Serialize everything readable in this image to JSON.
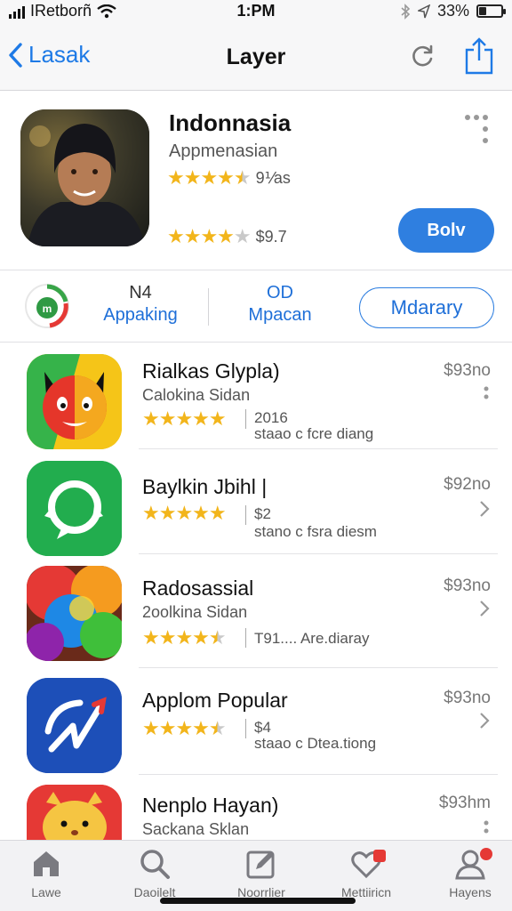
{
  "status_bar": {
    "carrier": "IRetborñ",
    "time": "1:PM",
    "battery_percent_label": "33%",
    "battery_level": 0.33
  },
  "nav": {
    "back_label": "Lasak",
    "title": "Layer"
  },
  "featured_app": {
    "name": "Indonnasia",
    "subtitle": "Appmenasian",
    "rating_1": 4.5,
    "rating_1_meta": "9⅟as",
    "rating_2": 4,
    "rating_2_meta": "$9.7",
    "buy_label": "Bolv"
  },
  "stats": {
    "stat_1_top": "N4",
    "stat_1_bottom": "Appaking",
    "stat_2_top": "OD",
    "stat_2_bottom": "Mpacan",
    "details_label": "Mdarary"
  },
  "apps": [
    {
      "name": "Rialkas Glypla)",
      "subtitle": "Calokina Sidan",
      "rating": 5,
      "meta_line_1": "2016",
      "meta_line_2": "staao c fcre diang",
      "price": "$93no",
      "accessory": "dots"
    },
    {
      "name": "Baylkin Jbihl |",
      "subtitle": "",
      "rating": 5,
      "meta_line_1": "$2",
      "meta_line_2": "stano c fsra diesm",
      "price": "$92no",
      "accessory": "chevron"
    },
    {
      "name": "Radosassial",
      "subtitle": "2oolkina Sidan",
      "rating": 4.5,
      "meta_line_1": "T91.... Are.diaray",
      "meta_line_2": "",
      "price": "$93no",
      "accessory": "chevron"
    },
    {
      "name": "Applom Popular",
      "subtitle": "",
      "rating": 4.5,
      "meta_line_1": "$4",
      "meta_line_2": "staao c Dtea.tiong",
      "price": "$93no",
      "accessory": "chevron"
    },
    {
      "name": "Nenplo Hayan)",
      "subtitle": "Sackana Sklan",
      "rating": 0,
      "meta_line_1": "",
      "meta_line_2": "",
      "price": "$93hm",
      "accessory": "dots"
    }
  ],
  "tabs": [
    {
      "label": "Lawe",
      "icon": "home-icon"
    },
    {
      "label": "Daoilelt",
      "icon": "search-icon"
    },
    {
      "label": "Noorrlier",
      "icon": "edit-icon"
    },
    {
      "label": "Mettiiricn",
      "icon": "heart-icon"
    },
    {
      "label": "Hayens",
      "icon": "person-icon"
    }
  ],
  "colors": {
    "accent": "#2f7fe0",
    "star": "#f2b51b",
    "badge": "#e53935"
  }
}
